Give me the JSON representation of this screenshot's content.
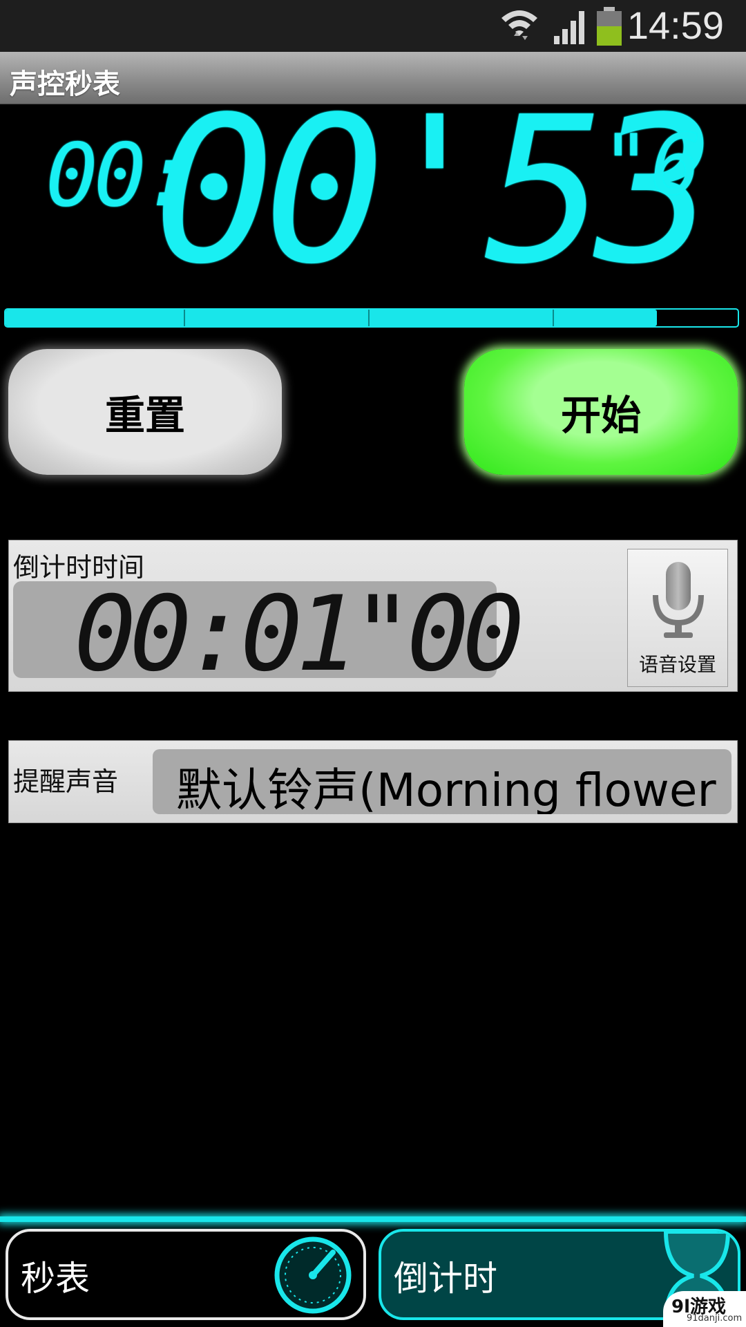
{
  "status_bar": {
    "time": "14:59",
    "icons": [
      "wifi-icon",
      "signal-icon",
      "battery-icon"
    ]
  },
  "app": {
    "title": "声控秒表"
  },
  "stopwatch": {
    "hours": "00:",
    "minutes_seconds": "00'53",
    "tenths": "\"6",
    "progress": 0.89,
    "accent_color": "#19e6ea"
  },
  "buttons": {
    "reset_label": "重置",
    "start_label": "开始",
    "start_color": "#4cf033"
  },
  "countdown": {
    "label": "倒计时时间",
    "value": "00:01\"00",
    "voice_label": "语音设置",
    "voice_icon": "microphone-icon"
  },
  "ringtone": {
    "label": "提醒声音",
    "value": "默认铃声(Morning flower"
  },
  "tabs": [
    {
      "label": "秒表",
      "icon": "stopwatch-icon",
      "active": false
    },
    {
      "label": "倒计时",
      "icon": "hourglass-icon",
      "active": true
    }
  ],
  "watermark": {
    "text": "9l游戏",
    "sub": "91danji.com"
  }
}
